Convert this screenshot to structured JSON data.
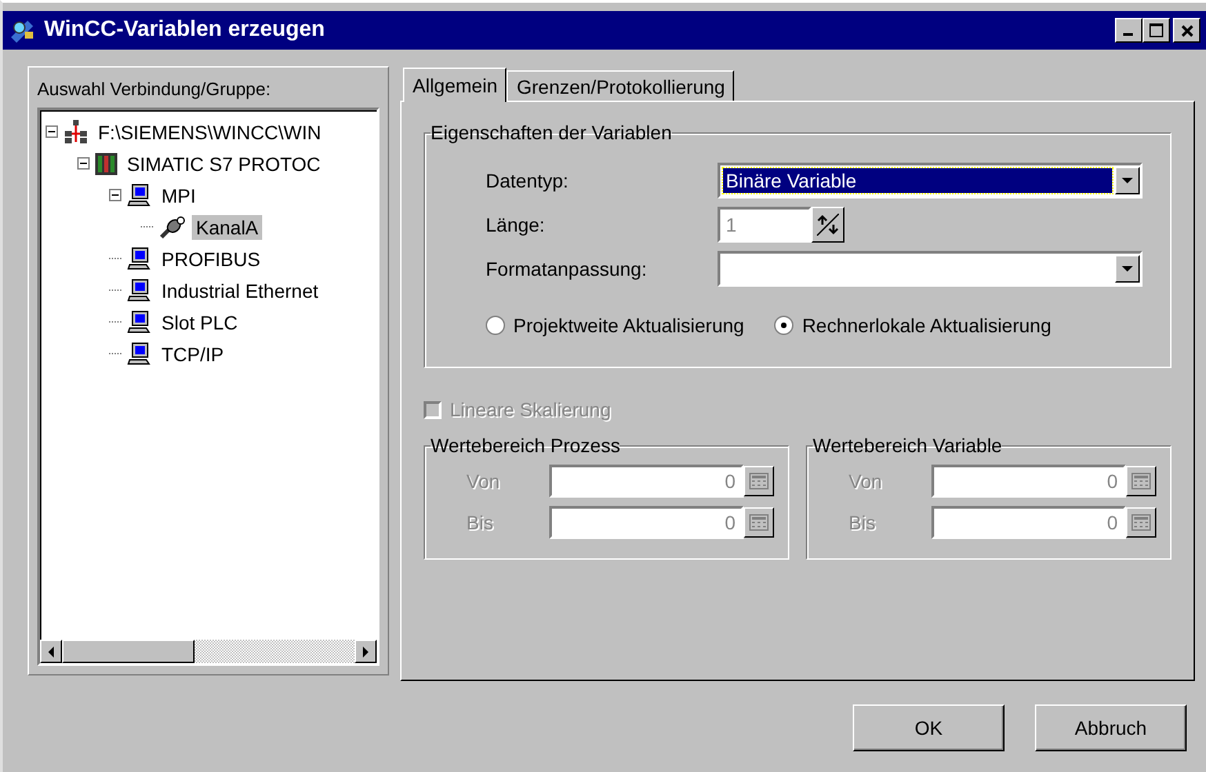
{
  "window": {
    "title": "WinCC-Variablen erzeugen"
  },
  "tree_panel": {
    "label": "Auswahl Verbindung/Gruppe:",
    "items": [
      {
        "label": "F:\\SIEMENS\\WINCC\\WIN",
        "kind": "network",
        "expanded": true,
        "selected": false,
        "children": [
          {
            "label": "SIMATIC S7 PROTOC",
            "kind": "plc",
            "expanded": true,
            "selected": false,
            "children": [
              {
                "label": "MPI",
                "kind": "computer",
                "expanded": true,
                "selected": false,
                "children": [
                  {
                    "label": "KanalA",
                    "kind": "channel",
                    "selected": true
                  }
                ]
              },
              {
                "label": "PROFIBUS",
                "kind": "computer",
                "selected": false
              },
              {
                "label": "Industrial Ethernet",
                "kind": "computer",
                "selected": false
              },
              {
                "label": "Slot PLC",
                "kind": "computer",
                "selected": false
              },
              {
                "label": "TCP/IP",
                "kind": "computer",
                "selected": false
              }
            ]
          }
        ]
      }
    ]
  },
  "tabs": [
    {
      "label": "Allgemein",
      "selected": true
    },
    {
      "label": "Grenzen/Protokollierung",
      "selected": false
    }
  ],
  "properties": {
    "title": "Eigenschaften der Variablen",
    "datentyp": {
      "label": "Datentyp:",
      "value": "Binäre Variable"
    },
    "laenge": {
      "label": "Länge:",
      "value": "1",
      "disabled": true
    },
    "format": {
      "label": "Formatanpassung:"
    },
    "radios": [
      {
        "label": "Projektweite Aktualisierung",
        "selected": false
      },
      {
        "label": "Rechnerlokale Aktualisierung",
        "selected": true
      }
    ]
  },
  "scaling": {
    "label": "Lineare Skalierung",
    "checked": false,
    "disabled": true
  },
  "ranges": [
    {
      "title": "Wertebereich Prozess",
      "rows": [
        {
          "label": "Von",
          "value": "0"
        },
        {
          "label": "Bis",
          "value": "0"
        }
      ]
    },
    {
      "title": "Wertebereich Variable",
      "rows": [
        {
          "label": "Von",
          "value": "0"
        },
        {
          "label": "Bis",
          "value": "0"
        }
      ]
    }
  ],
  "buttons": [
    "OK",
    "Abbruch"
  ]
}
